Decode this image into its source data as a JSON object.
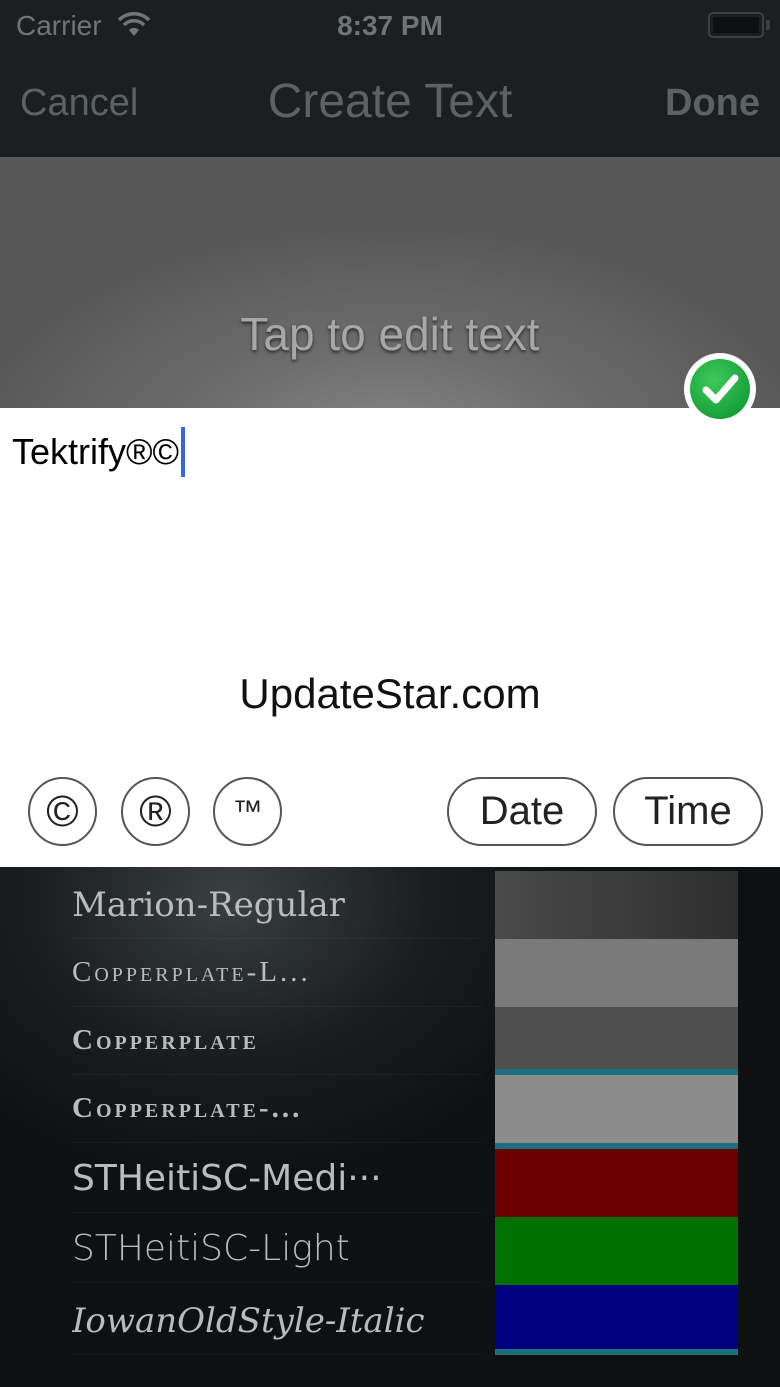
{
  "status_bar": {
    "carrier": "Carrier",
    "time": "8:37 PM"
  },
  "nav": {
    "cancel_label": "Cancel",
    "title": "Create Text",
    "done_label": "Done"
  },
  "preview": {
    "placeholder": "Tap to edit text"
  },
  "editor": {
    "text": "Tektrify®©",
    "watermark": "UpdateStar.com"
  },
  "symbols": {
    "copyright": "©",
    "registered": "®",
    "trademark": "™",
    "date_label": "Date",
    "time_label": "Time"
  },
  "fonts": [
    "Marion-Regular",
    "Copperplate-L...",
    "Copperplate",
    "Copperplate-...",
    "STHeitiSC-Medi···",
    "STHeitiSC-Light",
    "IowanOldStyle-Italic"
  ],
  "colors": {
    "swatches": [
      "#3b3b3b",
      "#7a7a7a",
      "#4f4f4f",
      "#8c8c8c",
      "#6b0000",
      "#007000",
      "#000080"
    ],
    "accent_check": "#1aa23a",
    "caret": "#3a62e6"
  }
}
